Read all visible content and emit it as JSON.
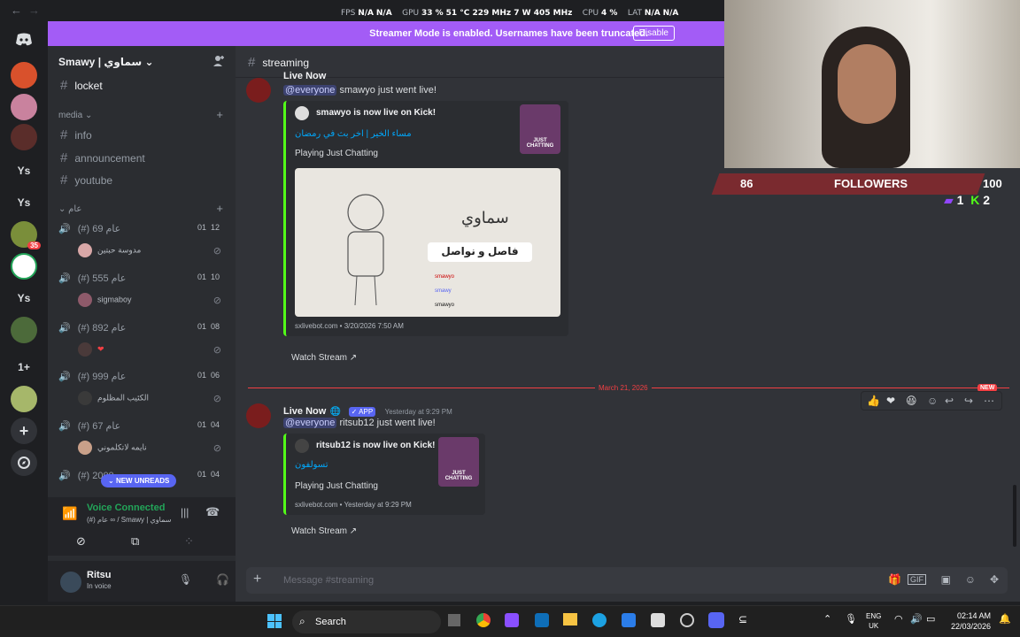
{
  "topbar": {
    "back": "←",
    "forward": "→",
    "window_title": "Smawy | سماوي",
    "stats": [
      {
        "k": "FPS",
        "v": "N/A",
        "v2": "N/A"
      },
      {
        "k": "GPU",
        "v": "33 %",
        "v2": "51 °C  229 MHz  7 W  405 MHz"
      },
      {
        "k": "CPU",
        "v": "4 %"
      },
      {
        "k": "LAT",
        "v": "N/A",
        "v2": "N/A"
      }
    ]
  },
  "streamer_mode": {
    "text": "Streamer Mode is enabled. Usernames have been truncated.",
    "button": "Disable"
  },
  "guilds": {
    "labels": [
      "Ys",
      "Ys",
      "Ys",
      "1+"
    ],
    "badge": "35"
  },
  "server": {
    "name": "Smawy | سماوي"
  },
  "channels": {
    "locket": "locket",
    "category_media": "media",
    "text": [
      "info",
      "announcement",
      "youtube"
    ],
    "category_arabic": "عام",
    "voice": [
      {
        "name": "(#) عام 69",
        "count_a": "01",
        "count_b": "12",
        "user": "مدوسة حبتين"
      },
      {
        "name": "(#) عام 555",
        "count_a": "01",
        "count_b": "10",
        "user": "sigmaboy"
      },
      {
        "name": "(#) عام 892",
        "count_a": "01",
        "count_b": "08",
        "user": "❤"
      },
      {
        "name": "(#) عام 999",
        "count_a": "01",
        "count_b": "06",
        "user": "الكئيب المظلوم"
      },
      {
        "name": "(#) عام 67",
        "count_a": "01",
        "count_b": "04",
        "user": "نايمه لاتكلموني"
      },
      {
        "name": "(#) 2000",
        "count_a": "01",
        "count_b": "04",
        "user": ""
      }
    ],
    "new_unreads": "NEW UNREADS"
  },
  "voice": {
    "status": "Voice Connected",
    "channel": "(#) عام ∞ / Smawy | سماوي"
  },
  "user": {
    "name": "Ritsu",
    "status": "In voice"
  },
  "chat": {
    "channel": "streaming",
    "msg1": {
      "author": "Live Now",
      "mention": "@everyone",
      "text": "smawyo just went live!",
      "embed": {
        "author": "smawyo is now live on Kick!",
        "title": "مساء الخير | اخر بث في رمضان",
        "desc": "Playing Just Chatting",
        "image_text_1": "سماوي",
        "image_text_2": "فاصل و نواصل",
        "socials": [
          "smawyo",
          "smawy",
          "smawyo"
        ],
        "thumb": "JUST CHATTING",
        "footer": "sxlivebot.com • 3/20/2026 7:50 AM"
      },
      "watch": "Watch Stream"
    },
    "divider_date": "March 21, 2026",
    "new_label": "NEW",
    "msg2": {
      "author": "Live Now",
      "tag": "✓ APP",
      "time": "Yesterday at 9:29 PM",
      "mention": "@everyone",
      "text": "ritsub12 just went live!",
      "embed": {
        "author": "ritsub12 is now live on Kick!",
        "title": "تسولفون",
        "desc": "Playing Just Chatting",
        "thumb": "JUST CHATTING",
        "footer": "sxlivebot.com • Yesterday at 9:29 PM"
      },
      "watch": "Watch Stream"
    },
    "input_placeholder": "Message #streaming"
  },
  "overlay": {
    "followers_count": "86",
    "followers_label": "FOLLOWERS",
    "followers_goal": "100",
    "twitch": "1",
    "kick": "2"
  },
  "taskbar": {
    "search": "Search",
    "lang1": "ENG",
    "lang2": "UK",
    "time": "02:14 AM",
    "date": "22/03/2026"
  }
}
